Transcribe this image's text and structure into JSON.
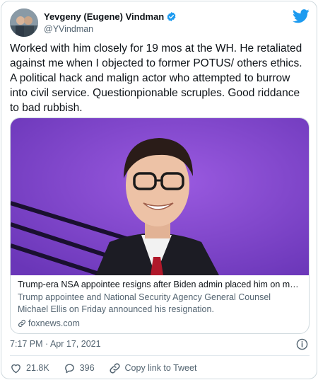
{
  "author": {
    "display_name": "Yevgeny (Eugene) Vindman",
    "handle": "@YVindman",
    "verified": true
  },
  "tweet": {
    "text": "Worked with him closely for 19 mos at the WH. He retaliated against me when I objected to former POTUS/ others ethics. A political hack and malign actor who attempted to burrow into civil service. Questionpionable scruples. Good riddance to bad rubbish.",
    "timestamp": "7:17 PM · Apr 17, 2021"
  },
  "card": {
    "title": "Trump-era NSA appointee resigns after Biden admin placed him on mo…",
    "description": "Trump appointee and National Security Agency General Counsel Michael Ellis on Friday announced his resignation.",
    "domain": "foxnews.com"
  },
  "actions": {
    "likes": "21.8K",
    "replies": "396",
    "copy_link": "Copy link to Tweet"
  },
  "colors": {
    "twitter_blue": "#1d9bf0",
    "secondary_text": "#536471",
    "card_background": "#7b47c8"
  },
  "icons": {
    "verified": "verified-badge-icon",
    "logo": "twitter-bird-icon",
    "info": "info-icon",
    "link": "link-icon",
    "like": "heart-icon",
    "reply": "reply-bubble-icon",
    "copy_link": "chain-link-icon"
  }
}
